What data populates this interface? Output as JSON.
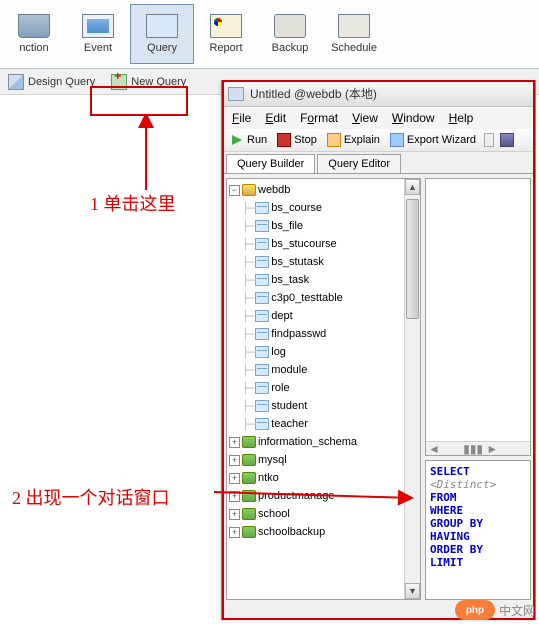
{
  "toolbar": {
    "items": [
      {
        "label": "nction",
        "name": "connection-button"
      },
      {
        "label": "Event",
        "name": "event-button"
      },
      {
        "label": "Query",
        "name": "query-button",
        "active": true
      },
      {
        "label": "Report",
        "name": "report-button"
      },
      {
        "label": "Backup",
        "name": "backup-button"
      },
      {
        "label": "Schedule",
        "name": "schedule-button"
      }
    ]
  },
  "subtoolbar": {
    "design_label": "Design Query",
    "new_label": "New Query"
  },
  "annotations": {
    "step1": "1 单击这里",
    "step2": "2 出现一个对话窗口"
  },
  "window": {
    "title": "Untitled @webdb (本地)",
    "menu": {
      "file": "File",
      "edit": "Edit",
      "format": "Format",
      "view": "View",
      "window": "Window",
      "help": "Help"
    },
    "actions": {
      "run": "Run",
      "stop": "Stop",
      "explain": "Explain",
      "export": "Export Wizard"
    },
    "tabs": {
      "builder": "Query Builder",
      "editor": "Query Editor"
    },
    "tree": {
      "root": "webdb",
      "tables": [
        "bs_course",
        "bs_file",
        "bs_stucourse",
        "bs_stutask",
        "bs_task",
        "c3p0_testtable",
        "dept",
        "findpasswd",
        "log",
        "module",
        "role",
        "student",
        "teacher"
      ],
      "databases": [
        "information_schema",
        "mysql",
        "ntko",
        "productmanage",
        "school",
        "schoolbackup"
      ]
    },
    "sql_keywords": [
      "SELECT",
      "FROM",
      "WHERE",
      "GROUP BY",
      "HAVING",
      "ORDER BY",
      "LIMIT"
    ],
    "sql_distinct": "<Distinct>"
  },
  "watermark": {
    "badge": "php",
    "text": "中文网"
  }
}
